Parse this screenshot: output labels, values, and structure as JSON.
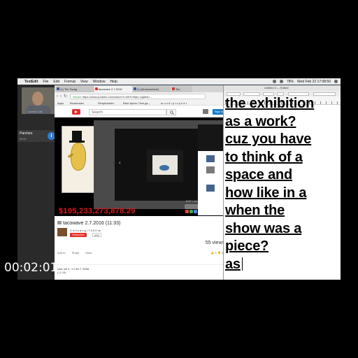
{
  "menubar": {
    "app_name": "TextEdit",
    "items": [
      "File",
      "Edit",
      "Format",
      "View",
      "Window",
      "Help"
    ],
    "clock": "Wed Feb 22  17:08:50",
    "battery": "78%"
  },
  "call": {
    "current_call_label": "Current Call",
    "caller_name": "Parches",
    "duration": "53:11"
  },
  "browser": {
    "tabs": [
      "(1) Tim Tsang",
      "tacowave 2.7.2016",
      "(1) (timemachine)",
      "Tim"
    ],
    "url_secure_label": "Secure",
    "url": "https://www.youtube.com/watch?v=WHVVejtz-Ug&list=...",
    "bookmarks": [
      "Apps",
      "Bookmarks",
      "SimpleAdder",
      "Bare Aphex Twin ga...",
      "m o n k • p r o p h e t"
    ],
    "youtube": {
      "search_placeholder": "Search",
      "signin_label": "Sign in",
      "price_overlay": "$195,233,273,878.29",
      "player_controls": "0:07 / 11:33",
      "video_title": "tacowave 2.7.2016 (11:33)",
      "channel_name": "t i m  t s a n g  /  7 5 6 0  vs.",
      "subscribe_label": "Subscribe",
      "subscriber_count": "655",
      "views": "55 views",
      "actions": [
        "Add to",
        "Share",
        "More"
      ],
      "likes": "0",
      "dislikes": "0",
      "uploaded": "Uploaded on Feb 7, 2016",
      "description": "(11:33)"
    }
  },
  "textedit": {
    "title": "Untitled 3 — Edited",
    "lines": [
      "the exhibition",
      "as a work?",
      "cuz you have",
      "to think of a",
      "space and",
      "how like in a",
      "when the",
      "show was a",
      "piece?",
      "as"
    ]
  },
  "overlay": {
    "timecode": "00:02:01;06"
  },
  "colors": {
    "youtube_red": "#e52d27",
    "price_red": "#e01818",
    "call_blue": "#2d7fd6",
    "end_call_red": "#e23b2e"
  }
}
